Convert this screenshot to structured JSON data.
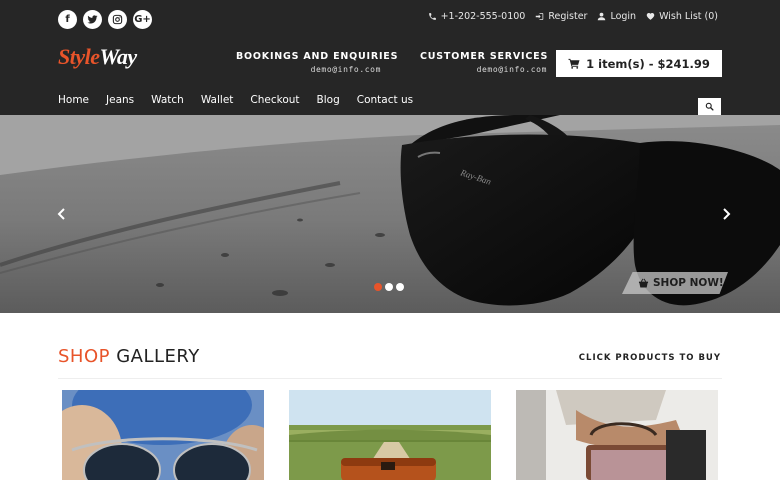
{
  "header": {
    "social": [
      {
        "icon": "facebook-icon",
        "glyph": "f"
      },
      {
        "icon": "twitter-icon",
        "glyph": ""
      },
      {
        "icon": "instagram-icon",
        "glyph": ""
      },
      {
        "icon": "google-plus-icon",
        "glyph": "G+"
      }
    ],
    "phone": "+1-202-555-0100",
    "register": "Register",
    "login": "Login",
    "wishlist": "Wish List (0)",
    "logo_part1": "Style",
    "logo_part2": "Way",
    "bookings_title": "BOOKINGS AND ENQUIRIES",
    "bookings_email": "demo@info.com",
    "customer_title": "CUSTOMER SERVICES",
    "customer_email": "demo@info.com",
    "cart_label": "1 item(s) - $241.99",
    "nav": [
      "Home",
      "Jeans",
      "Watch",
      "Wallet",
      "Checkout",
      "Blog",
      "Contact us"
    ]
  },
  "hero": {
    "brand_on_glasses": "Ray-Ban",
    "shop_now": "SHOP NOW!",
    "slides": 3,
    "active_slide": 1
  },
  "gallery": {
    "title_accent": "SHOP",
    "title_rest": "GALLERY",
    "subtitle": "CLICK PRODUCTS TO BUY",
    "products": [
      "sunglasses-product",
      "leather-bag-product",
      "handbag-product"
    ]
  },
  "colors": {
    "header_bg": "#262626",
    "accent": "#e8542a",
    "white": "#ffffff"
  }
}
